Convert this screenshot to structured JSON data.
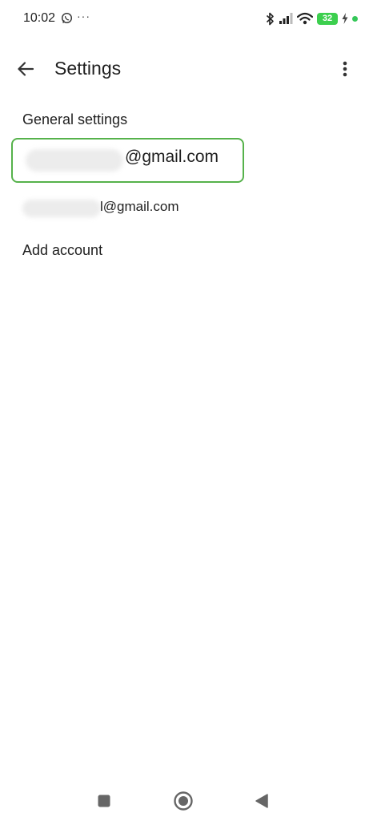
{
  "status_bar": {
    "time": "10:02",
    "more_indicator": "···",
    "battery_level": "32",
    "battery_color": "#3ccf4e",
    "icons": [
      "whatsapp-icon",
      "bluetooth-icon",
      "cellular-signal-icon",
      "wifi-icon",
      "battery-icon",
      "charging-icon"
    ]
  },
  "app_bar": {
    "title": "Settings",
    "back_icon": "arrow-left-icon",
    "overflow_icon": "more-vert-icon"
  },
  "settings_list": {
    "general_settings": "General settings",
    "accounts": [
      {
        "visible_suffix": "@gmail.com",
        "selected": true
      },
      {
        "visible_suffix": "l@gmail.com",
        "selected": false
      }
    ],
    "add_account": "Add account",
    "highlight_color": "#56b24b"
  },
  "nav_bar": {
    "buttons": [
      "recents-square-icon",
      "home-circle-icon",
      "back-triangle-icon"
    ]
  }
}
